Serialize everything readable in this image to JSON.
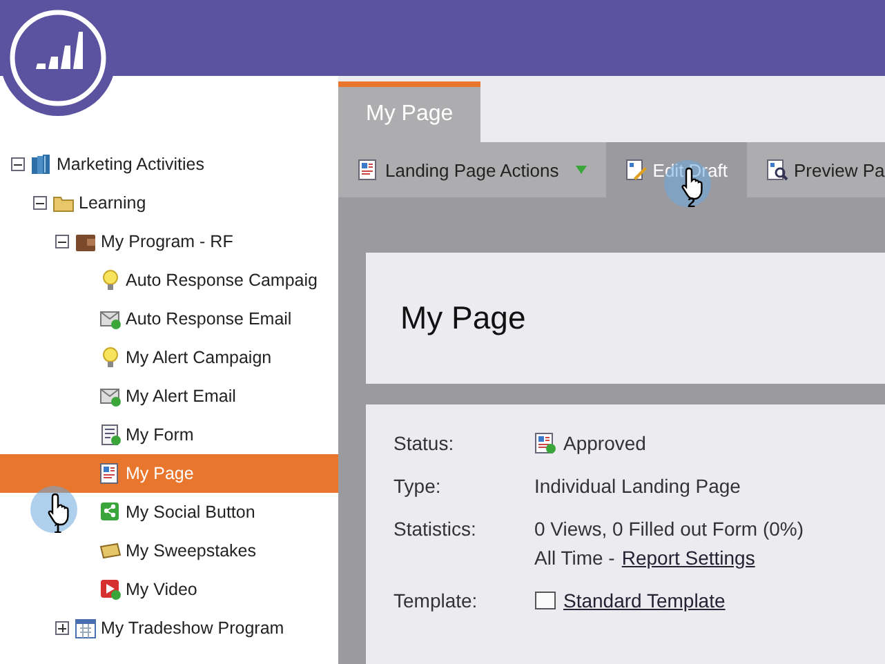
{
  "tree": [
    {
      "label": "Marketing Activities",
      "kind": "library",
      "expanded": true,
      "selected": false,
      "children": [
        {
          "label": "Learning",
          "kind": "folder",
          "expanded": true,
          "selected": false,
          "children": [
            {
              "label": "My Program - RF",
              "kind": "program",
              "expanded": true,
              "selected": false,
              "children": [
                {
                  "label": "Auto Response Campaig",
                  "kind": "bulb",
                  "selected": false
                },
                {
                  "label": "Auto Response Email",
                  "kind": "email",
                  "selected": false
                },
                {
                  "label": "My Alert Campaign",
                  "kind": "bulb",
                  "selected": false
                },
                {
                  "label": "My Alert Email",
                  "kind": "email",
                  "selected": false
                },
                {
                  "label": "My Form",
                  "kind": "form",
                  "selected": false
                },
                {
                  "label": "My Page",
                  "kind": "page",
                  "selected": true,
                  "cursor": "1"
                },
                {
                  "label": "My Social Button",
                  "kind": "social",
                  "selected": false
                },
                {
                  "label": "My Sweepstakes",
                  "kind": "ticket",
                  "selected": false
                },
                {
                  "label": "My Video",
                  "kind": "video",
                  "selected": false
                }
              ]
            },
            {
              "label": "My Tradeshow Program",
              "kind": "calendar",
              "expanded": false,
              "selected": false
            }
          ]
        }
      ]
    }
  ],
  "tabs": [
    {
      "label": "My Page",
      "selected": true
    }
  ],
  "toolbar": [
    {
      "label": "Landing Page Actions",
      "kind": "page",
      "dropdown": true,
      "selected": false
    },
    {
      "label": "Edit Draft",
      "kind": "edit",
      "dropdown": false,
      "selected": true,
      "cursor": "2"
    },
    {
      "label": "Preview Pa",
      "kind": "preview",
      "dropdown": false,
      "selected": false
    }
  ],
  "page_title": "My Page",
  "details": [
    {
      "label": "Status:",
      "kind": "status",
      "value": "Approved"
    },
    {
      "label": "Type:",
      "kind": "text",
      "value": "Individual Landing Page"
    },
    {
      "label": "Statistics:",
      "kind": "stats",
      "value": "0 Views, 0 Filled out Form (0%)",
      "prefix": "All Time - ",
      "link": "Report Settings"
    },
    {
      "label": "Template:",
      "kind": "template",
      "link": "Standard Template"
    }
  ]
}
